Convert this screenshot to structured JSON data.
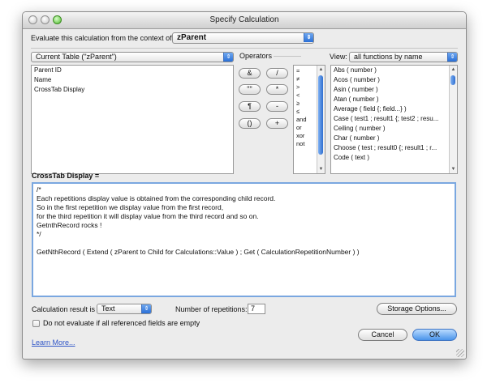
{
  "window": {
    "title": "Specify Calculation"
  },
  "context": {
    "label": "Evaluate this calculation from the context of:",
    "selected": "zParent"
  },
  "fields_panel": {
    "table_selected": "Current Table (\"zParent\")",
    "items": [
      "Parent ID",
      "Name",
      "CrossTab Display"
    ]
  },
  "operators": {
    "label": "Operators",
    "buttons": [
      "&",
      "/",
      "\"\"",
      "*",
      "¶",
      "-",
      "()",
      "+"
    ],
    "list": [
      "=",
      "≠",
      ">",
      "<",
      "≥",
      "≤",
      "and",
      "or",
      "xor",
      "not"
    ]
  },
  "functions": {
    "view_label": "View:",
    "view_selected": "all functions by name",
    "items": [
      "Abs ( number )",
      "Acos ( number )",
      "Asin ( number )",
      "Atan ( number )",
      "Average ( field {; field...} )",
      "Case ( test1 ; result1 {; test2 ; resu...",
      "Ceiling ( number )",
      "Char ( number )",
      "Choose ( test ; result0 {; result1 ; r...",
      "Code ( text )"
    ]
  },
  "formula": {
    "field_label": "CrossTab Display =",
    "lines": [
      "/*",
      "Each repetitions display value is obtained from the corresponding child record.",
      "So in the first repetition we display value from the first record,",
      "for the third repetition it will display value from the third record and so on.",
      "GetnthRecord rocks !",
      "*/",
      "",
      "GetNthRecord ( Extend ( zParent to Child for Calculations::Value ) ; Get ( CalculationRepetitionNumber ) )"
    ]
  },
  "result": {
    "label": "Calculation result is",
    "type": "Text"
  },
  "repetitions": {
    "label": "Number of repetitions:",
    "value": "7"
  },
  "storage_button": "Storage Options...",
  "do_not_evaluate_label": "Do not evaluate if all referenced fields are empty",
  "learn_more": "Learn More...",
  "cancel_button": "Cancel",
  "ok_button": "OK",
  "colors": {
    "accent": "#4a94ea",
    "focus_border": "#7aa7e0",
    "link": "#2f55c7"
  },
  "icons": [
    "close-light",
    "minimize-light",
    "zoom-light",
    "popup-arrow-icon",
    "scroll-up-icon",
    "scroll-down-icon",
    "resize-grip-icon"
  ]
}
